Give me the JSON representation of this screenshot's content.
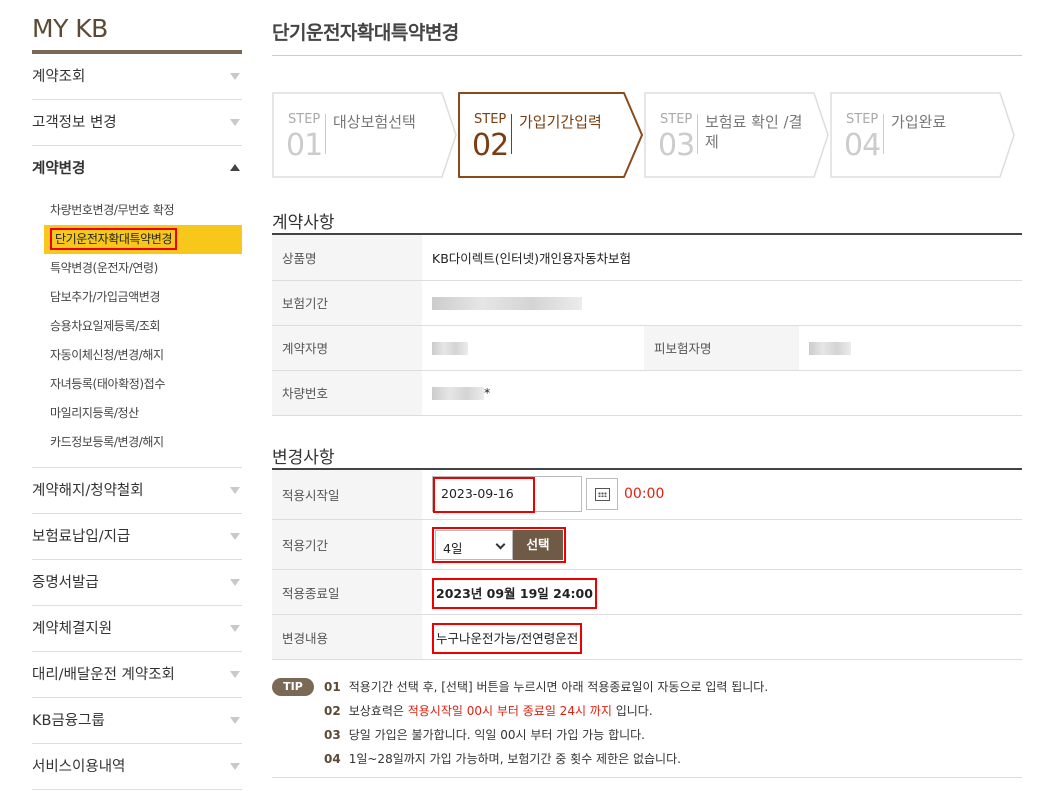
{
  "sidebar": {
    "brand": "MY KB",
    "items": [
      {
        "label": "계약조회"
      },
      {
        "label": "고객정보 변경"
      },
      {
        "label": "계약변경"
      },
      {
        "label": "계약해지/청약철회"
      },
      {
        "label": "보험료납입/지급"
      },
      {
        "label": "증명서발급"
      },
      {
        "label": "계약체결지원"
      },
      {
        "label": "대리/배달운전 계약조회"
      },
      {
        "label": "KB금융그룹"
      },
      {
        "label": "서비스이용내역"
      }
    ],
    "subitems": [
      "차량번호변경/무번호 확정",
      "단기운전자확대특약변경",
      "특약변경(운전자/연령)",
      "담보추가/가입금액변경",
      "승용차요일제등록/조회",
      "자동이체신청/변경/해지",
      "자녀등록(태아확정)접수",
      "마일리지등록/정산",
      "카드정보등록/변경/해지"
    ]
  },
  "main": {
    "title": "단기운전자확대특약변경",
    "steps": [
      {
        "label": "STEP",
        "num": "01",
        "name": "대상보험선택"
      },
      {
        "label": "STEP",
        "num": "02",
        "name": "가입기간입력"
      },
      {
        "label": "STEP",
        "num": "03",
        "name": "보험료 확인 /결제"
      },
      {
        "label": "STEP",
        "num": "04",
        "name": "가입완료"
      }
    ],
    "contract": {
      "section_title": "계약사항",
      "product_label": "상품명",
      "product_value": "KB다이렉트(인터넷)개인용자동차보험",
      "period_label": "보험기간",
      "holder_label": "계약자명",
      "insured_label": "피보험자명",
      "car_label": "차량번호",
      "car_suffix": "*"
    },
    "change": {
      "section_title": "변경사항",
      "start_label": "적용시작일",
      "start_value": "2023-09-16",
      "start_time": "00:00",
      "period_label": "적용기간",
      "period_value": "4일",
      "select_button": "선택",
      "end_label": "적용종료일",
      "end_value": "2023년 09월 19일 24:00",
      "content_label": "변경내용",
      "content_value": "누구나운전가능/전연령운전"
    },
    "tips": {
      "badge": "TIP",
      "rows": [
        {
          "num": "01",
          "text": "적용기간 선택 후, [선택] 버튼을 누르시면 아래 적용종료일이 자동으로 입력 됩니다."
        },
        {
          "num": "02",
          "pre": "보상효력은 ",
          "red": "적용시작일 00시 부터 종료일 24시 까지",
          "post": " 입니다."
        },
        {
          "num": "03",
          "text": "당일 가입은 불가합니다. 익일 00시 부터 가입 가능 합니다."
        },
        {
          "num": "04",
          "text": "1일~28일까지 가입 가능하며, 보험기간 중 횟수 제한은 없습니다."
        }
      ]
    }
  }
}
